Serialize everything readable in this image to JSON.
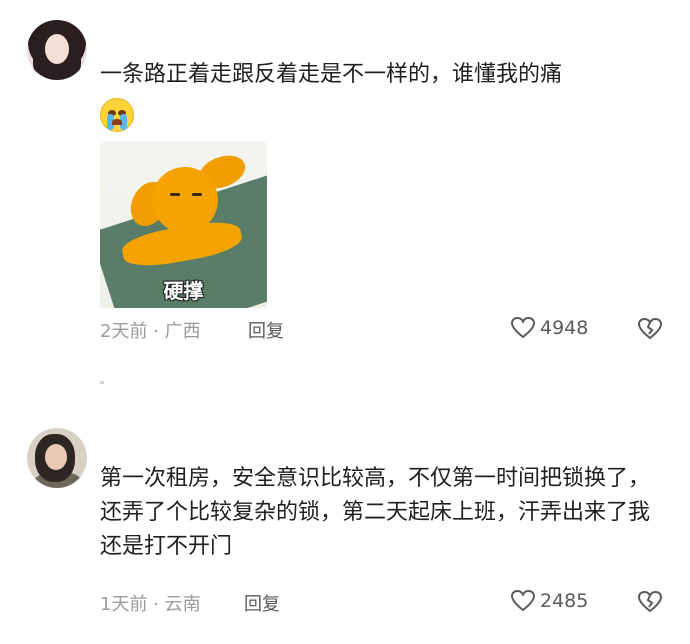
{
  "comments": [
    {
      "text": "一条路正着走跟反着走是不一样的，谁懂我的痛",
      "emoji": "crying-face",
      "sticker": {
        "caption": "硬撑"
      },
      "time_location": "2天前 · 广西",
      "reply_label": "回复",
      "like_count": "4948",
      "icons": {
        "like": "heart-outline-icon",
        "dislike": "broken-heart-icon"
      }
    },
    {
      "text": "第一次租房，安全意识比较高，不仅第一时间把锁换了，还弄了个比较复杂的锁，第二天起床上班，汗弄出来了我还是打不开门",
      "time_location": "1天前 · 云南",
      "reply_label": "回复",
      "like_count": "2485",
      "icons": {
        "like": "heart-outline-icon",
        "dislike": "broken-heart-icon"
      }
    }
  ],
  "colors": {
    "text": "#1f1f1f",
    "meta": "#9b9b9b",
    "sticker_dog": "#f5a300"
  }
}
